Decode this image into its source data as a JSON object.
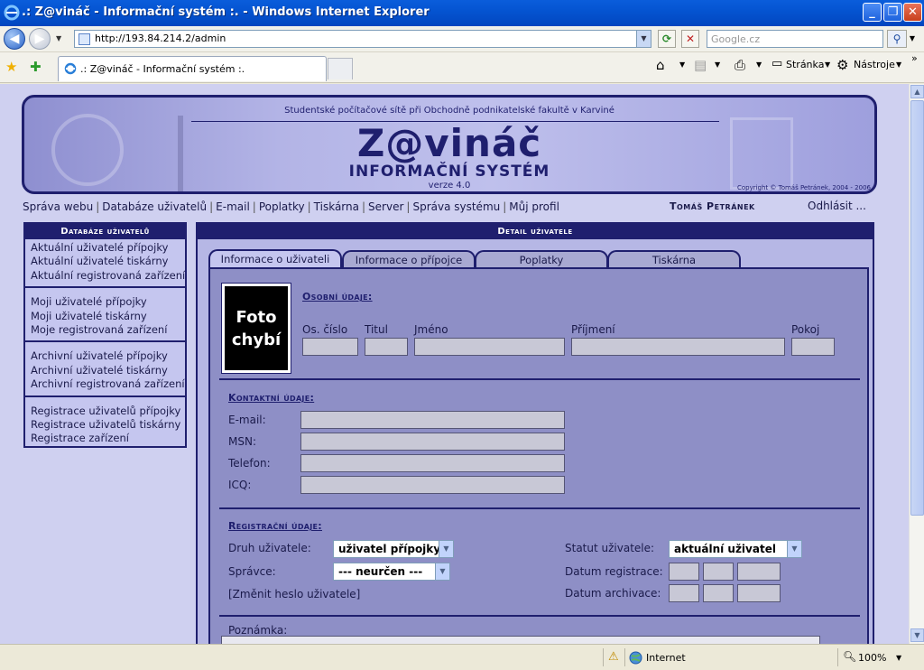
{
  "window": {
    "title": ".: Z@vináč - Informační systém :. - Windows Internet Explorer",
    "minimize": "_",
    "maximize": "❐",
    "close": "✕"
  },
  "address_bar": {
    "url": "http://193.84.214.2/admin",
    "search_placeholder": "Google.cz"
  },
  "tab": {
    "label": ".: Z@vináč - Informační systém :."
  },
  "commands": {
    "page": "Stránka",
    "tools": "Nástroje"
  },
  "header": {
    "school": "Studentské počítačové sítě při Obchodně podnikatelské fakultě v Karviné",
    "logo": "Z@vináč",
    "subtitle": "INFORMAČNÍ SYSTÉM",
    "version": "verze 4.0",
    "copyright": "Copyright © Tomáš Petránek, 2004 - 2006"
  },
  "topmenu": {
    "items": [
      "Správa webu",
      "Databáze uživatelů",
      "E-mail",
      "Poplatky",
      "Tiskárna",
      "Server",
      "Správa systému",
      "Můj profil"
    ],
    "user": "Tomáš Petránek",
    "logout": "Odhlásit ..."
  },
  "sidebar": {
    "title": "Databáze uživatelů",
    "groups": [
      [
        "Aktuální uživatelé přípojky",
        "Aktuální uživatelé tiskárny",
        "Aktuální registrovaná zařízení"
      ],
      [
        "Moji uživatelé přípojky",
        "Moji uživatelé tiskárny",
        "Moje registrovaná zařízení"
      ],
      [
        "Archivní uživatelé přípojky",
        "Archivní uživatelé tiskárny",
        "Archivní registrovaná zařízení"
      ],
      [
        "Registrace uživatelů přípojky",
        "Registrace uživatelů tiskárny",
        "Registrace zařízení"
      ]
    ]
  },
  "main": {
    "title": "Detail uživatele",
    "tabs": [
      "Informace o uživateli",
      "Informace o přípojce",
      "Poplatky",
      "Tiskárna"
    ],
    "photo": "Foto chybí",
    "personal": {
      "title": "Osobní údaje:",
      "labels": [
        "Os. číslo",
        "Titul",
        "Jméno",
        "Příjmení",
        "Pokoj"
      ]
    },
    "contact": {
      "title": "Kontaktní údaje:",
      "labels": [
        "E-mail:",
        "MSN:",
        "Telefon:",
        "ICQ:"
      ]
    },
    "registration": {
      "title": "Registrační údaje:",
      "user_type_label": "Druh uživatele:",
      "user_type_value": "uživatel přípojky",
      "admin_label": "Správce:",
      "admin_value": "--- neurčen ---",
      "change_password": "[Změnit heslo uživatele]",
      "status_label": "Statut uživatele:",
      "status_value": "aktuální uživatel",
      "reg_date_label": "Datum registrace:",
      "archive_date_label": "Datum archivace:"
    },
    "note_label": "Poznámka:"
  },
  "statusbar": {
    "zone": "Internet",
    "zoom": "100%"
  }
}
